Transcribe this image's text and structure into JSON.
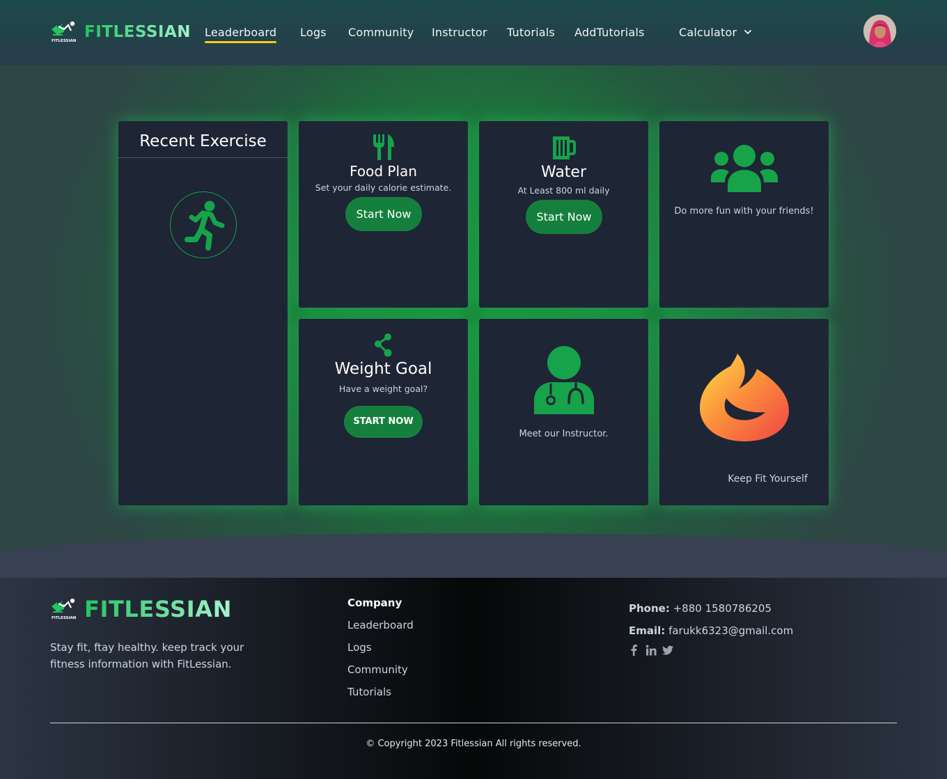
{
  "brand": {
    "name": "FITLESSIAN",
    "tiny": "FITLESSIAN",
    "accent": "#22c55e"
  },
  "nav": {
    "items": [
      {
        "label": "Leaderboard"
      },
      {
        "label": "Logs"
      },
      {
        "label": "Community"
      },
      {
        "label": "Instructor"
      },
      {
        "label": "Tutorials"
      },
      {
        "label": "AddTutorials"
      },
      {
        "label": "Calculator"
      }
    ],
    "active_color": "#facc15"
  },
  "cards": {
    "recent": {
      "title": "Recent Exercise",
      "icon": "running-person-icon"
    },
    "food": {
      "title": "Food Plan",
      "subtitle": "Set your daily calorie estimate.",
      "button": "Start Now",
      "icon": "fork-knife-icon"
    },
    "water": {
      "title": "Water",
      "subtitle": "At Least 800 ml daily",
      "button": "Start Now",
      "icon": "mug-icon"
    },
    "friends": {
      "subtitle": "Do more fun with your friends!",
      "icon": "users-icon"
    },
    "weight": {
      "title": "Weight Goal",
      "subtitle": "Have a weight goal?",
      "button": "START NOW",
      "icon": "node-share-icon"
    },
    "instructor": {
      "subtitle": "Meet our Instructor.",
      "icon": "doctor-icon"
    },
    "fit": {
      "subtitle": "Keep Fit Yourself",
      "icon": "flame-icon"
    }
  },
  "footer": {
    "tagline": "Stay fit, ftay healthy. keep track your fitness information with FitLessian.",
    "company_heading": "Company",
    "links": [
      {
        "label": "Leaderboard"
      },
      {
        "label": "Logs"
      },
      {
        "label": "Community"
      },
      {
        "label": "Tutorials"
      }
    ],
    "phone_label": "Phone:",
    "phone": "+880 1580786205",
    "email_label": "Email:",
    "email": "farukk6323@gmail.com",
    "social": [
      "facebook-icon",
      "linkedin-icon",
      "twitter-icon"
    ],
    "copyright": "© Copyright 2023 Fitlessian All rights reserved."
  }
}
